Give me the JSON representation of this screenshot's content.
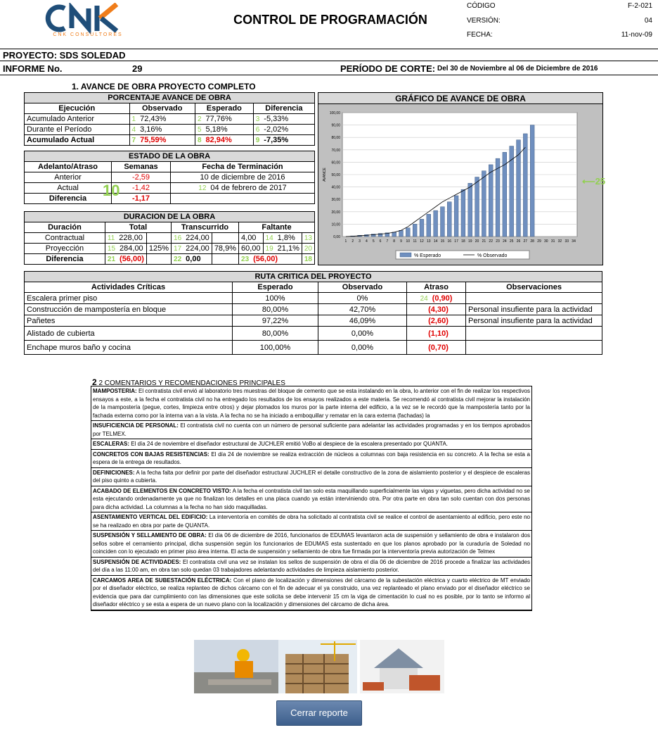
{
  "header": {
    "logo_text": "CNK",
    "logo_sub": "CNK CONSULTORES",
    "title": "CONTROL DE PROGRAMACIÓN",
    "codigo_label": "CÓDIGO",
    "codigo": "F-2-021",
    "version_label": "VERSIÓN:",
    "version": "04",
    "fecha_label": "FECHA:",
    "fecha": "11-nov-09"
  },
  "proyecto": "PROYECTO: SDS SOLEDAD",
  "informe_label": "INFORME No.",
  "informe_no": "29",
  "periodo_label": "PERÍODO DE CORTE:",
  "periodo": "Del 30 de Noviembre al 06 de Diciembre de 2016",
  "section1_title": "1. AVANCE DE OBRA PROYECTO COMPLETO",
  "avance": {
    "band": "PORCENTAJE AVANCE DE OBRA",
    "headers": [
      "Ejecución",
      "Observado",
      "Esperado",
      "Diferencia"
    ],
    "rows": [
      {
        "label": "Acumulado Anterior",
        "m1": "1",
        "obs": "72,43%",
        "m2": "2",
        "esp": "77,76%",
        "m3": "3",
        "dif": "-5,33%"
      },
      {
        "label": "Durante el Período",
        "m1": "4",
        "obs": "3,16%",
        "m2": "5",
        "esp": "5,18%",
        "m3": "6",
        "dif": "-2,02%"
      },
      {
        "label": "Acumulado Actual",
        "m1": "7",
        "obs": "75,59%",
        "m2": "8",
        "esp": "82,94%",
        "m3": "9",
        "dif": "-7,35%"
      }
    ]
  },
  "estado": {
    "band": "ESTADO DE LA OBRA",
    "headers": [
      "Adelanto/Atraso",
      "Semanas",
      "Fecha de Terminación"
    ],
    "rows": [
      {
        "label": "Anterior",
        "sem": "-2,59",
        "m": "",
        "fecha": "10 de diciembre de 2016"
      },
      {
        "label": "Actual",
        "sem": "-1,42",
        "m": "12",
        "fecha": "04 de febrero de 2017"
      },
      {
        "label": "Diferencia",
        "sem": "-1,17",
        "m": "",
        "fecha": ""
      }
    ],
    "big_marker": "10"
  },
  "duracion": {
    "band": "DURACION DE LA OBRA",
    "headers": [
      "Duración",
      "Total",
      "Transcurrido",
      "Faltante"
    ],
    "rows": [
      {
        "label": "Contractual",
        "m1": "11",
        "total": "228,00",
        "pct1": "",
        "m2": "16",
        "trans": "224,00",
        "pct2": "",
        "m3": "14",
        "falt": "4,00",
        "pct3": "1,8%",
        "m4": "13"
      },
      {
        "label": "Proyección",
        "m1": "15",
        "total": "284,00",
        "pct1": "125%",
        "m2": "17",
        "trans": "224,00",
        "pct2": "78,9%",
        "m3": "19",
        "falt": "60,00",
        "pct3": "21,1%",
        "m4": "20"
      },
      {
        "label": "Diferencia",
        "m1": "21",
        "total": "(56,00)",
        "pct1": "",
        "m2": "22",
        "trans": "0,00",
        "pct2": "",
        "m3": "23",
        "falt": "(56,00)",
        "pct3": "",
        "m4": "18"
      }
    ]
  },
  "chart_title": "GRÁFICO DE AVANCE DE OBRA",
  "chart_marker": "25",
  "chart_data": {
    "type": "bar",
    "title": "",
    "ylabel": "AVANCE",
    "ylim": [
      0,
      100
    ],
    "yticks": [
      "0,00",
      "10,00",
      "20,00",
      "30,00",
      "40,00",
      "50,00",
      "60,00",
      "70,00",
      "80,00",
      "90,00",
      "100,00"
    ],
    "categories": [
      "1",
      "2",
      "3",
      "4",
      "5",
      "6",
      "7",
      "8",
      "9",
      "10",
      "11",
      "12",
      "13",
      "14",
      "15",
      "16",
      "17",
      "18",
      "19",
      "20",
      "21",
      "22",
      "23",
      "24",
      "25",
      "26",
      "27",
      "28",
      "29",
      "30",
      "31",
      "32",
      "33",
      "34"
    ],
    "series": [
      {
        "name": "% Esperado",
        "type": "bar",
        "values": [
          0,
          0.5,
          1,
          1.5,
          2,
          2.5,
          3,
          3.5,
          5,
          7,
          10,
          14,
          18,
          21,
          24,
          28,
          33,
          38,
          43,
          48,
          53,
          58,
          63,
          68,
          73,
          78,
          83,
          90,
          null,
          null,
          null,
          null,
          null,
          null
        ]
      },
      {
        "name": "% Observado",
        "type": "line",
        "values": [
          0,
          0.3,
          0.6,
          1,
          1.5,
          2,
          2.5,
          3.5,
          5,
          8,
          12,
          16,
          20,
          24,
          28,
          31,
          34,
          37,
          40,
          44,
          48,
          52,
          55,
          58,
          62,
          66,
          72,
          null,
          null,
          null,
          null,
          null,
          null,
          null
        ]
      }
    ],
    "legend": "bottom"
  },
  "ruta": {
    "band": "RUTA CRITICA DEL PROYECTO",
    "headers": [
      "Actividades Críticas",
      "Esperado",
      "Observado",
      "Atraso",
      "Observaciones"
    ],
    "rows": [
      {
        "act": "Escalera primer piso",
        "esp": "100%",
        "obs": "0%",
        "m": "24",
        "atr": "(0,90)",
        "ob": ""
      },
      {
        "act": "Construcción de mampostería en bloque",
        "esp": "80,00%",
        "obs": "42,70%",
        "m": "",
        "atr": "(4,30)",
        "ob": "Personal insufiente para la actividad"
      },
      {
        "act": "Pañetes",
        "esp": "97,22%",
        "obs": "46,09%",
        "m": "",
        "atr": "(2,60)",
        "ob": "Personal insufiente para la actividad"
      },
      {
        "act": "Alistado de cubierta",
        "esp": "80,00%",
        "obs": "0,00%",
        "m": "",
        "atr": "(1,10)",
        "ob": ""
      },
      {
        "act": "Enchape muros baño y cocina",
        "esp": "100,00%",
        "obs": "0,00%",
        "m": "",
        "atr": "(0,70)",
        "ob": ""
      }
    ]
  },
  "section2_title": "2 COMENTARIOS Y RECOMENDACIONES PRINCIPALES",
  "comments": [
    {
      "head": "MAMPOSTERIA:",
      "text": "El contratista civil envió al laboratorio tres muestras del bloque de cemento que se esta instalando en la obra, lo anterior con el fin de realizar los respectivos ensayos a este, a la fecha el contratista civil no ha entregado los resultados de los ensayos realizados a este materia. Se recomendó al contratista civil mejorar la instalación de la mampostería (pegue, cortes, limpieza entre otros) y dejar plomados los muros por la parte interna del edificio, a la vez se le recordó que la mampostería tanto por la fachada externa como por la interna van a la vista. A la fecha no se ha iniciado a emboquillar y rematar en la cara externa (fachadas) la"
    },
    {
      "head": "INSUFICIENCIA DE PERSONAL:",
      "text": "El contratista civil no cuenta con un número de personal suficiente para adelantar las actividades programadas y en los tiempos aprobados por TELMEX."
    },
    {
      "head": "ESCALERAS:",
      "text": "El día 24 de noviembre el diseñador estructural de JUCHLER emitió VoBo al despiece de la escalera presentado por QUANTA."
    },
    {
      "head": "CONCRETOS CON BAJAS RESISTENCIAS:",
      "text": "El día 24 de noviembre se realiza extracción de núcleos a columnas con baja resistencia en su concreto. A la fecha se esta a espera de la entrega de resultados."
    },
    {
      "head": "DEFINICIONES:",
      "text": "A la fecha falta por definir por parte del diseñador estructural JUCHLER el detalle constructivo de la zona de aislamiento posterior y el despiece de escaleras del piso quinto a cubierta."
    },
    {
      "head": "ACABADO DE ELEMENTOS EN CONCRETO VISTO:",
      "text": "A la fecha el contratista civil tan solo esta maquillando superficialmente las vigas y viguetas, pero dicha actividad no se esta ejecutando ordenadamente ya que no finalizan los detalles en una placa cuando ya están interviniendo otra. Por otra parte en obra tan solo cuentan con dos personas para dicha actividad. La columnas a la fecha no han sido maquilladas."
    },
    {
      "head": "ASENTAMIENTO VERTICAL DEL EDIFICIO:",
      "text": "La interventoría en comités de obra ha solicitado al contratista civil se realice el control de asentamiento al edificio, pero este no se ha realizado en obra por parte de QUANTA."
    },
    {
      "head": "SUSPENSIÓN Y SELLAMIENTO DE OBRA:",
      "text": "El día 06 de diciembre de 2016, funcionarios de EDUMAS levantaron acta de suspensión y sellamiento de obra e instalaron dos sellos sobre el cerramiento principal, dicha suspensión según los funcionarios de EDUMAS esta sustentado en que los planos aprobado por la curaduría de Soledad no coinciden con lo ejecutado en primer piso área interna. El acta de suspensión y sellamiento de obra fue firmada por la interventoría previa autorización de Telmex"
    },
    {
      "head": "SUSPENSIÓN DE ACTIVIDADES:",
      "text": "El contratista civil una vez se instalan los sellos de suspensión de obra el día 06 de diciembre de 2016 procede a finalizar las actividades del día a las 11:00 am, en obra tan solo quedan 03 trabajadores adelantando actividades de limpieza aislamiento posterior."
    },
    {
      "head": "CARCAMOS AREA DE SUBESTACIÓN ELÉCTRICA:",
      "text": "Con el plano de localización y dimensiones del cárcamo de la subestación eléctrica y cuarto eléctrico de MT enviado por el diseñador eléctrico, se realiza replanteo de dichos cárcamo con el fin de adecuar el ya construido, una vez replanteado el plano enviado por el diseñador eléctrico se evidencia que para dar cumplimiento con las dimensiones que este solicita se debe intervenir 15 cm la viga de cimentación lo cual no es posible, por lo tanto se informo al diseñador eléctrico y se esta a espera de un nuevo plano con la localización y dimensiones del cárcamo de dicha área."
    }
  ],
  "close_button": "Cerrar   reporte"
}
